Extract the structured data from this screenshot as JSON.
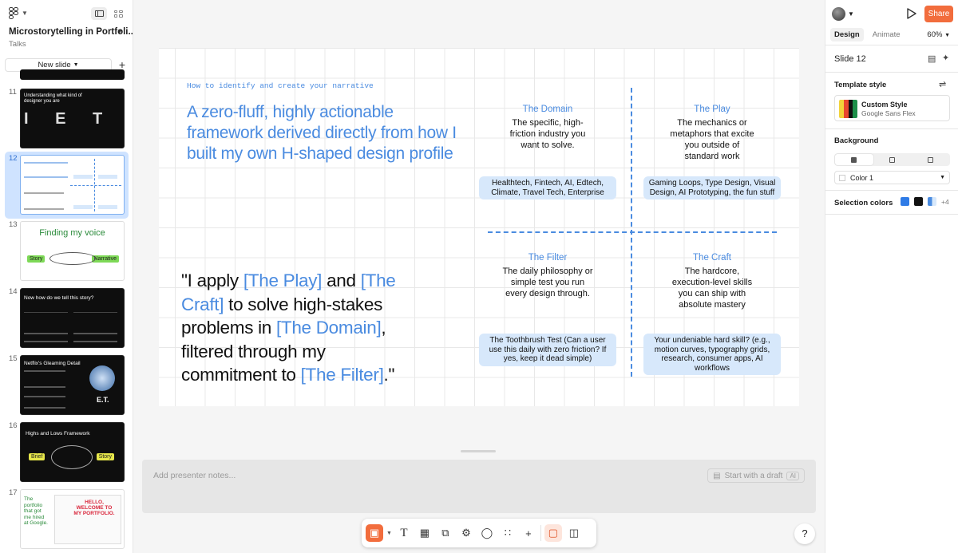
{
  "file": {
    "title": "Microstorytelling in Portfoli...",
    "project": "Talks"
  },
  "sidebar": {
    "new_slide_label": "New slide",
    "thumbnails": [
      {
        "num": "11",
        "title": "Understanding what kind of designer you are",
        "letters": "I E T H"
      },
      {
        "num": "12",
        "selected": true
      },
      {
        "num": "13",
        "title": "Finding my voice",
        "left": "Story",
        "right": "Narrative"
      },
      {
        "num": "14",
        "title": "Now how do we tell this story?"
      },
      {
        "num": "15",
        "title": "Netflix's Gleaming Detail",
        "badge": "E.T."
      },
      {
        "num": "16",
        "title": "Highs and Lows Framework",
        "left": "Brief",
        "right": "Story"
      },
      {
        "num": "17",
        "title": "The portfolio that got me hired at Google.",
        "poster": "HELLO, WELCOME TO MY PORTFOLIO."
      }
    ]
  },
  "slide": {
    "kicker": "How to identify and create your narrative",
    "headline": "A zero-fluff, highly actionable framework derived directly from how I built my own H-shaped design profile",
    "quote": {
      "p1": "\"I apply ",
      "h1": "[The Play]",
      "p2": " and ",
      "h2": "[The Craft]",
      "p3": " to solve high-stakes problems in ",
      "h3": "[The Domain]",
      "p4": ", filtered through my commitment to ",
      "h4": "[The Filter]",
      "p5": ".\""
    },
    "quadrants": [
      {
        "title": "The Domain",
        "desc": "The specific, high-friction industry you want to solve.",
        "example": "Healthtech, Fintech, AI, Edtech, Climate, Travel Tech, Enterprise"
      },
      {
        "title": "The Play",
        "desc": "The mechanics or metaphors that excite you outside of standard work",
        "example": "Gaming Loops, Type Design, Visual Design, AI Prototyping, the fun stuff"
      },
      {
        "title": "The Filter",
        "desc": "The daily philosophy or simple test you run every design through.",
        "example": "The Toothbrush Test (Can a user use this daily with zero friction? If yes, keep it dead simple)"
      },
      {
        "title": "The Craft",
        "desc": "The hardcore, execution-level skills you can ship with absolute mastery",
        "example": "Your undeniable hard skill? (e.g., motion curves, typography grids, research, consumer apps, AI workflows"
      }
    ]
  },
  "notes": {
    "placeholder": "Add presenter notes...",
    "draft_label": "Start with a draft",
    "ai_label": "AI"
  },
  "right_panel": {
    "share_label": "Share",
    "tabs": [
      "Design",
      "Animate"
    ],
    "zoom": "60%",
    "slide_name": "Slide 12",
    "template_style_label": "Template style",
    "template_name": "Custom Style",
    "template_font": "Google Sans Flex",
    "background_label": "Background",
    "color_label": "Color 1",
    "selection_colors_label": "Selection colors",
    "selection_more": "+4",
    "selection_colors": [
      "#2f7be6",
      "#111111",
      "#4a8be0"
    ]
  },
  "help_label": "?"
}
